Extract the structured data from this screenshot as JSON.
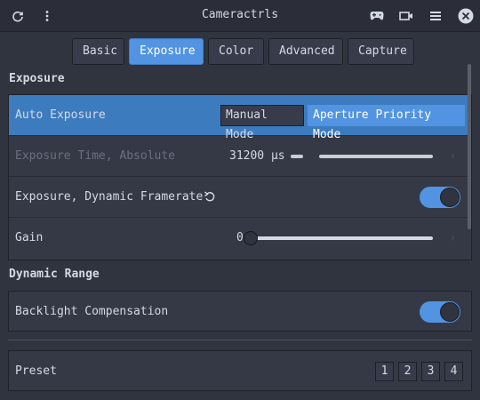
{
  "window": {
    "title": "Cameractrls"
  },
  "headerbar": {
    "refresh_icon": "refresh-icon",
    "menu_icon": "vertical-dots-icon",
    "gamepad_icon": "gamepad-icon",
    "camera_icon": "video-camera-icon",
    "hamburger_icon": "hamburger-menu-icon",
    "close_icon": "close-icon"
  },
  "tabs": [
    {
      "label": "Basic",
      "active": false
    },
    {
      "label": "Exposure",
      "active": true
    },
    {
      "label": "Color",
      "active": false
    },
    {
      "label": "Advanced",
      "active": false
    },
    {
      "label": "Capture",
      "active": false
    }
  ],
  "sections": {
    "exposure": {
      "title": "Exposure",
      "auto_exposure": {
        "label": "Auto Exposure",
        "options": [
          "Manual Mode",
          "Aperture Priority Mode"
        ],
        "selected": "Aperture Priority Mode"
      },
      "exposure_time": {
        "label": "Exposure Time, Absolute",
        "value": "31200 µs",
        "enabled": false
      },
      "dynamic_framerate": {
        "label": "Exposure, Dynamic Framerate",
        "reset_icon": "undo-icon",
        "enabled": true
      },
      "gain": {
        "label": "Gain",
        "value": "0"
      }
    },
    "dynamic_range": {
      "title": "Dynamic Range",
      "backlight": {
        "label": "Backlight Compensation",
        "enabled": true
      }
    },
    "preset": {
      "label": "Preset",
      "buttons": [
        "1",
        "2",
        "3",
        "4"
      ]
    }
  },
  "colors": {
    "accent": "#5294e2",
    "background": "#2f343f"
  }
}
